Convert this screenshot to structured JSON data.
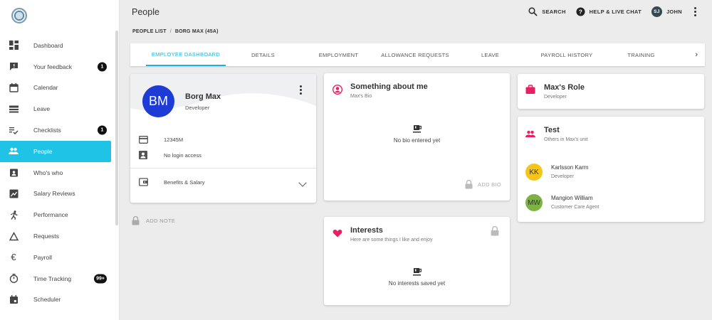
{
  "header": {
    "title": "People",
    "search_label": "SEARCH",
    "help_label": "HELP & LIVE CHAT",
    "user_initials": "SJ",
    "user_name": "JOHN"
  },
  "breadcrumb": {
    "root": "PEOPLE LIST",
    "separator": "/",
    "current": "BORG MAX (45A)"
  },
  "sidebar": {
    "items": [
      {
        "label": "Dashboard",
        "icon": "dashboard-icon",
        "badge": ""
      },
      {
        "label": "Your feedback",
        "icon": "feedback-icon",
        "badge": "1"
      },
      {
        "label": "Calendar",
        "icon": "calendar-icon",
        "badge": ""
      },
      {
        "label": "Leave",
        "icon": "leave-icon",
        "badge": ""
      },
      {
        "label": "Checklists",
        "icon": "checklist-icon",
        "badge": "1"
      },
      {
        "label": "People",
        "icon": "people-icon",
        "badge": ""
      },
      {
        "label": "Who's who",
        "icon": "badge-icon",
        "badge": ""
      },
      {
        "label": "Salary Reviews",
        "icon": "chart-icon",
        "badge": ""
      },
      {
        "label": "Performance",
        "icon": "run-icon",
        "badge": ""
      },
      {
        "label": "Requests",
        "icon": "triangle-icon",
        "badge": ""
      },
      {
        "label": "Payroll",
        "icon": "euro-icon",
        "badge": ""
      },
      {
        "label": "Time Tracking",
        "icon": "timer-icon",
        "badge": "99+"
      },
      {
        "label": "Scheduler",
        "icon": "scheduler-icon",
        "badge": ""
      }
    ]
  },
  "tabs": [
    {
      "label": "EMPLOYEE DASHBOARD"
    },
    {
      "label": "DETAILS"
    },
    {
      "label": "EMPLOYMENT"
    },
    {
      "label": "ALLOWANCE REQUESTS"
    },
    {
      "label": "LEAVE"
    },
    {
      "label": "PAYROLL HISTORY"
    },
    {
      "label": "TRAINING"
    }
  ],
  "profile": {
    "initials": "BM",
    "name": "Borg Max",
    "role": "Developer",
    "id_number": "12345M",
    "login": "No login access",
    "benefits": "Benefits & Salary"
  },
  "add_note_label": "ADD NOTE",
  "bio": {
    "title": "Something about me",
    "subtitle": "Max's Bio",
    "empty": "No bio entered yet",
    "add_label": "ADD BIO"
  },
  "interests": {
    "title": "Interests",
    "subtitle": "Here are some things I like and enjoy",
    "empty": "No interests saved yet"
  },
  "role_card": {
    "title": "Max's Role",
    "subtitle": "Developer"
  },
  "unit": {
    "title": "Test",
    "subtitle": "Others in Max's unit",
    "members": [
      {
        "initials": "KK",
        "name": "Karlsson Karm",
        "role": "Developer",
        "color": "#f5c518"
      },
      {
        "initials": "MW",
        "name": "Mangion William",
        "role": "Customer Care Agent",
        "color": "#7cb342"
      }
    ]
  },
  "colors": {
    "accent": "#1ec3e6",
    "avatar": "#1e3bd6",
    "heart": "#e91e63"
  }
}
